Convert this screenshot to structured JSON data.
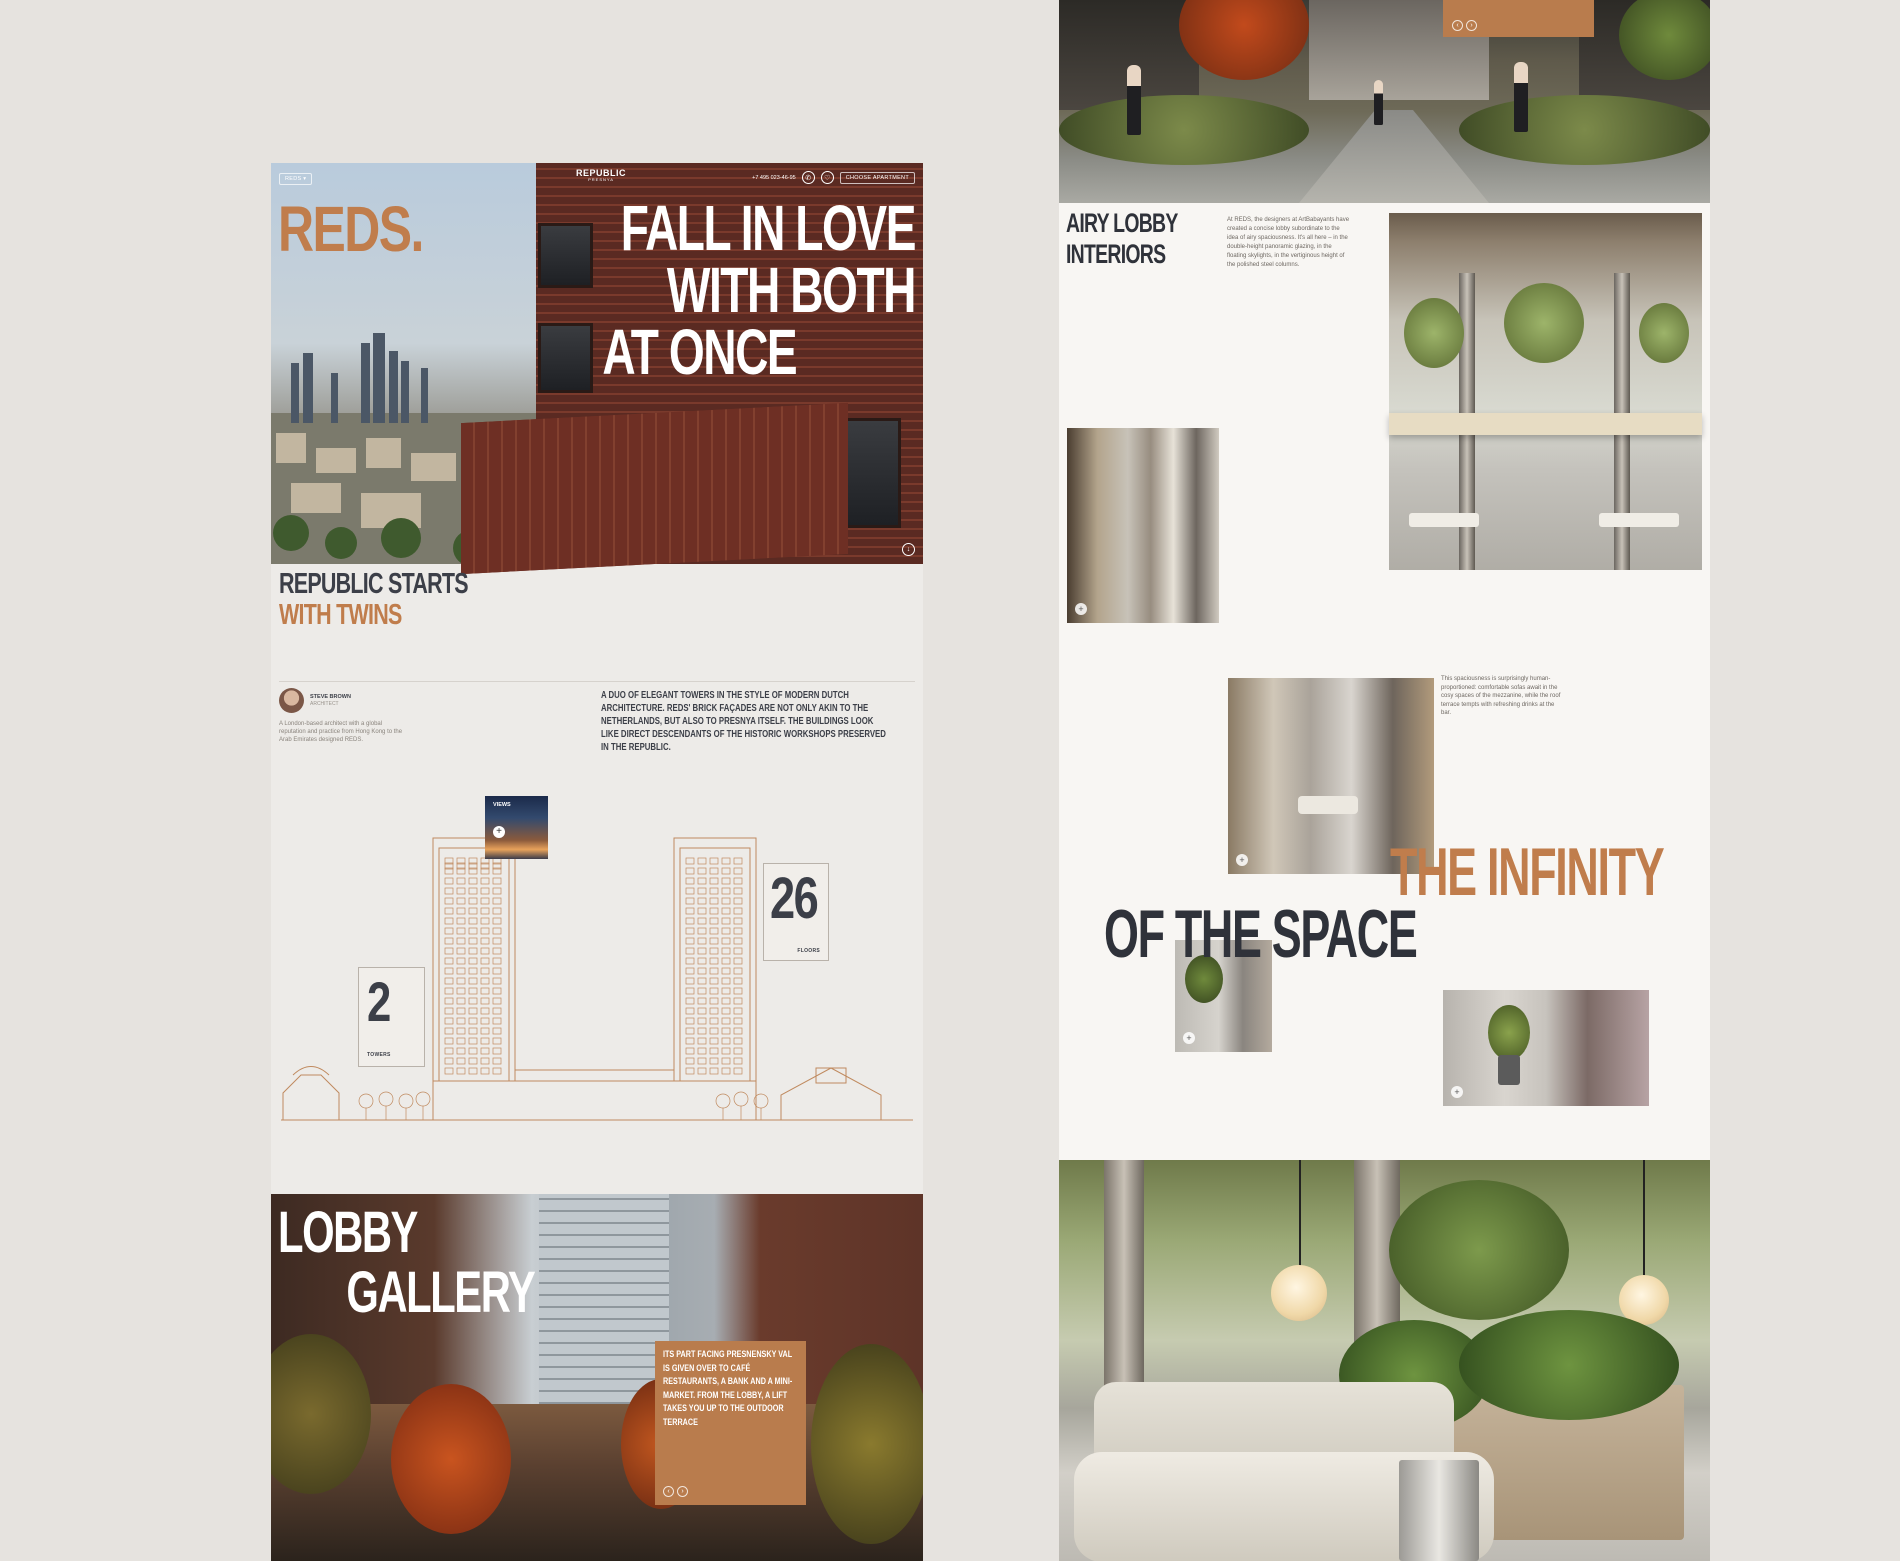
{
  "left_page": {
    "hero": {
      "menu_label": "REDS",
      "logo_title": "REPUBLIC",
      "logo_sub": "PRESNYA",
      "phone": "+7 495 023-46-95",
      "cta": "CHOOSE APARTMENT",
      "brand": "REDS.",
      "headline": [
        "FALL IN LOVE",
        "WITH BOTH",
        "AT ONCE"
      ]
    },
    "intro": {
      "title_line1": "REPUBLIC STARTS",
      "title_line2": "WITH TWINS",
      "architect_name": "STEVE BROWN",
      "architect_role": "ARCHITECT",
      "architect_bio": "A London-based architect with a global reputation and practice from Hong Kong to the Arab Emirates designed REDS.",
      "quote": "A DUO OF ELEGANT TOWERS IN THE STYLE OF MODERN DUTCH ARCHITECTURE. REDS' BRICK FAÇADES ARE NOT ONLY AKIN TO THE NETHERLANDS, BUT ALSO TO PRESNYA ITSELF. THE BUILDINGS LOOK LIKE DIRECT DESCENDANTS OF THE HISTORIC WORKSHOPS PRESERVED IN THE REPUBLIC."
    },
    "stats": {
      "views_label": "VIEWS",
      "towers_value": "2",
      "towers_label": "TOWERS",
      "floors_value": "26",
      "floors_label": "FLOORS"
    },
    "lobby": {
      "title_line1": "LOBBY",
      "title_line2": "GALLERY",
      "text": "ITS PART FACING PRESNENSKY VAL IS GIVEN OVER TO CAFÉ RESTAURANTS, A BANK AND A MINI-MARKET. FROM THE LOBBY, A LIFT TAKES YOU UP TO THE OUTDOOR TERRACE"
    }
  },
  "right_page": {
    "airy": {
      "title_line1": "AIRY LOBBY",
      "title_line2": "INTERIORS",
      "text": "At REDS, the designers at ArtBabayants have created a concise lobby subordinate to the idea of airy spaciousness. It's all here – in the double-height panoramic glazing, in the floating skylights, in the vertiginous height of the polished steel columns."
    },
    "space": {
      "text": "This spaciousness is surprisingly human-proportioned: comfortable sofas await in the cosy spaces of the mezzanine, while the roof terrace tempts with refreshing drinks at the bar.",
      "title_line1": "THE INFINITY",
      "title_line2": "OF THE SPACE"
    }
  },
  "colors": {
    "accent": "#c07d4c",
    "dark": "#3c3f48",
    "box": "#b97c4d",
    "bg": "#e6e3df"
  }
}
